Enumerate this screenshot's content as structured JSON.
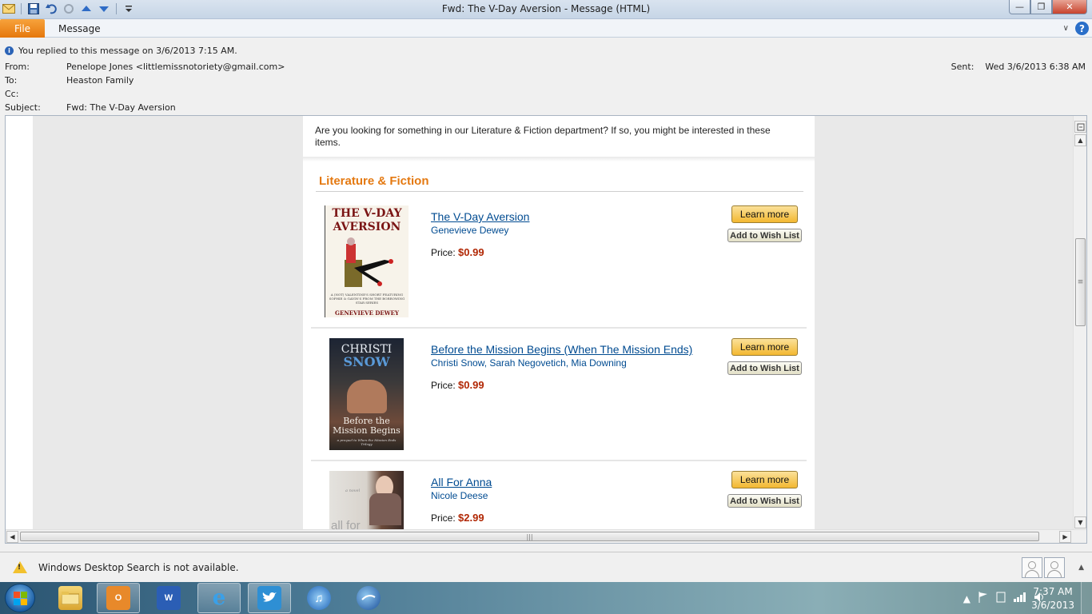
{
  "window": {
    "title": "Fwd: The V-Day Aversion  -  Message (HTML)",
    "min_label": "—",
    "max_label": "❐",
    "close_label": "✕"
  },
  "ribbon": {
    "file_tab": "File",
    "message_tab": "Message",
    "help_label": "?",
    "collapse_label": "∨"
  },
  "header": {
    "info": "You replied to this message on 3/6/2013 7:15 AM.",
    "from_label": "From:",
    "from_value": "Penelope Jones <littlemissnotoriety@gmail.com>",
    "to_label": "To:",
    "to_value": "Heaston Family",
    "cc_label": "Cc:",
    "cc_value": "",
    "subject_label": "Subject:",
    "subject_value": "Fwd: The V-Day Aversion",
    "sent_label": "Sent:",
    "sent_value": "Wed 3/6/2013 6:38 AM"
  },
  "body": {
    "intro": "Are you looking for something in our Literature & Fiction department? If so, you might be interested in these items.",
    "section_title": "Literature & Fiction",
    "learn_more_label": "Learn more",
    "wish_list_label": "Add to Wish List",
    "price_label": "Price:",
    "items": [
      {
        "title": "The V-Day Aversion",
        "author": "Genevieve Dewey",
        "price": "$0.99",
        "cover_title": "THE V-DAY AVERSION",
        "cover_tagline": "A (NOT) VALENTINE'S SHORT FEATURING SOPHIE & GAVIN'S FROM THE BORROWING STAR SERIES",
        "cover_author": "GENEVIEVE DEWEY"
      },
      {
        "title": "Before the Mission Begins (When The Mission Ends)",
        "author": "Christi Snow, Sarah Negovetich, Mia Downing",
        "price": "$0.99",
        "cover_name_top": "CHRISTI",
        "cover_name_bottom": "SNOW",
        "cover_title": "Before the Mission Begins",
        "cover_sub": "a prequel to When the Mission Ends Trilogy"
      },
      {
        "title": "All For Anna",
        "author": "Nicole Deese",
        "price": "$2.99",
        "cover_small": "a novel",
        "cover_title": "all for"
      }
    ]
  },
  "statusbar": {
    "warning": "Windows Desktop Search is not available.",
    "warn_glyph": "!"
  },
  "taskbar": {
    "apps": [
      "windows-explorer",
      "outlook",
      "word",
      "internet-explorer",
      "twitter",
      "itunes",
      "google-earth"
    ],
    "time": "7:37 AM",
    "date": "3/6/2013"
  },
  "colors": {
    "accent_orange": "#e47911",
    "link_blue": "#004b91",
    "price_red": "#b12704",
    "file_tab": "#e5770c"
  }
}
